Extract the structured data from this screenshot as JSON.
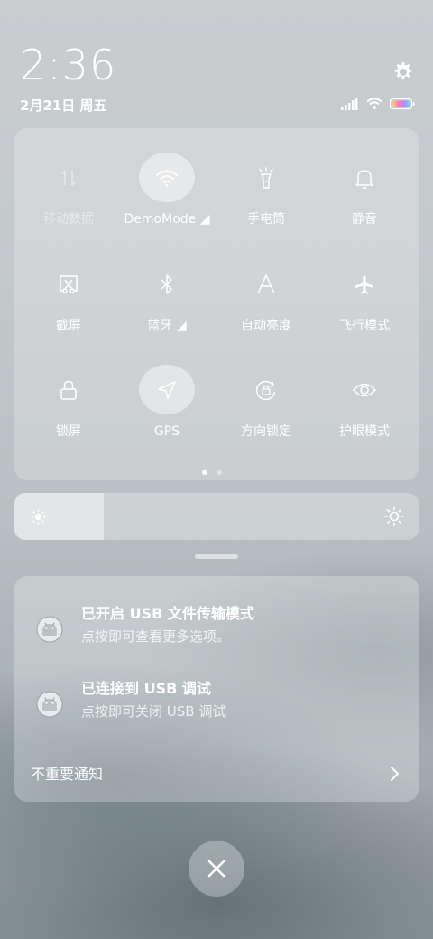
{
  "status": {
    "time": "2:36",
    "date": "2月21日 周五"
  },
  "tiles": [
    {
      "label": "移动数据",
      "icon": "mobile-data-icon",
      "on": false,
      "disabled": true
    },
    {
      "label": "DemoMode ◢",
      "icon": "wifi-icon",
      "on": true
    },
    {
      "label": "手电筒",
      "icon": "flashlight-icon",
      "on": false
    },
    {
      "label": "静音",
      "icon": "bell-icon",
      "on": false
    },
    {
      "label": "截屏",
      "icon": "screenshot-icon",
      "on": false
    },
    {
      "label": "蓝牙 ◢",
      "icon": "bluetooth-icon",
      "on": false
    },
    {
      "label": "自动亮度",
      "icon": "auto-brightness-icon",
      "on": false
    },
    {
      "label": "飞行模式",
      "icon": "airplane-icon",
      "on": false
    },
    {
      "label": "锁屏",
      "icon": "lock-icon",
      "on": false
    },
    {
      "label": "GPS",
      "icon": "gps-icon",
      "on": true
    },
    {
      "label": "方向锁定",
      "icon": "rotation-lock-icon",
      "on": false
    },
    {
      "label": "护眼模式",
      "icon": "eye-icon",
      "on": false
    }
  ],
  "brightness": {
    "level": 0.22
  },
  "notifications": [
    {
      "title": "已开启 USB 文件传输模式",
      "subtitle": "点按即可查看更多选项。",
      "icon": "android-icon"
    },
    {
      "title": "已连接到 USB 调试",
      "subtitle": "点按即可关闭 USB 调试",
      "icon": "android-icon"
    }
  ],
  "unimportant": {
    "label": "不重要通知"
  },
  "colors": {
    "panel": "rgba(255,255,255,0.22)",
    "text": "#ffffff"
  }
}
